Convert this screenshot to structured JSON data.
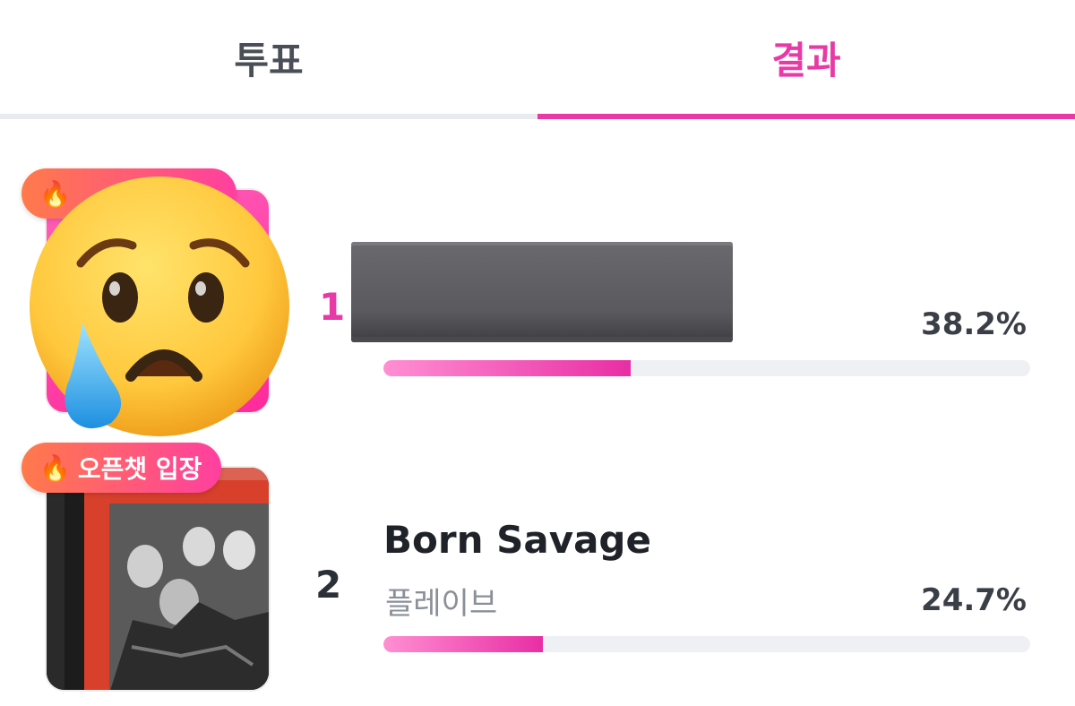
{
  "tabs": [
    {
      "label": "투표",
      "active": false
    },
    {
      "label": "결과",
      "active": true
    }
  ],
  "accent_color": "#e83aa6",
  "results": [
    {
      "rank": "1",
      "title": "",
      "artist": "",
      "percent_label": "38.2%",
      "percent": 38.2,
      "badge": {
        "icon": "flame-icon",
        "label": ""
      },
      "thumbnail": "crying-face-emoji",
      "redacted": true
    },
    {
      "rank": "2",
      "title": "Born Savage",
      "artist": "플레이브",
      "percent_label": "24.7%",
      "percent": 24.7,
      "badge": {
        "icon": "flame-icon",
        "label": "오픈챗 입장"
      },
      "thumbnail": "album-cover"
    }
  ]
}
